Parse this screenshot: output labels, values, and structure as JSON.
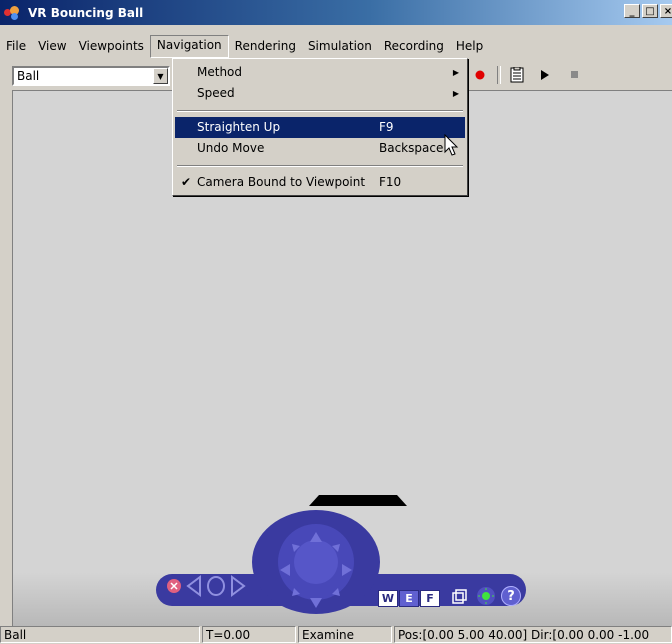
{
  "window": {
    "title": "VR Bouncing Ball",
    "controls": [
      "_",
      "□",
      "×"
    ]
  },
  "menubar": {
    "items": [
      "File",
      "View",
      "Viewpoints",
      "Navigation",
      "Rendering",
      "Simulation",
      "Recording",
      "Help"
    ],
    "active": "Navigation"
  },
  "toolbar": {
    "viewpoint_value": "Ball"
  },
  "navigation_menu": {
    "items": [
      {
        "label": "Method",
        "shortcut": "",
        "submenu": true
      },
      {
        "label": "Speed",
        "shortcut": "",
        "submenu": true
      },
      {
        "label": "Straighten Up",
        "shortcut": "F9",
        "highlighted": true
      },
      {
        "label": "Undo Move",
        "shortcut": "Backspace"
      },
      {
        "label": "Camera Bound to Viewpoint",
        "shortcut": "F10",
        "checked": true
      }
    ]
  },
  "navpanel": {
    "w_label": "W",
    "e_label": "E",
    "f_label": "F",
    "help_label": "?"
  },
  "statusbar": {
    "viewpoint": "Ball",
    "time": "T=0.00",
    "mode": "Examine",
    "position": "Pos:[0.00 5.00 40.00] Dir:[0.00 0.00 -1.00"
  },
  "colors": {
    "title_start": "#0a246a",
    "highlight": "#0a246a",
    "nav_panel": "#3a3aa0",
    "record_red": "#e00000"
  }
}
